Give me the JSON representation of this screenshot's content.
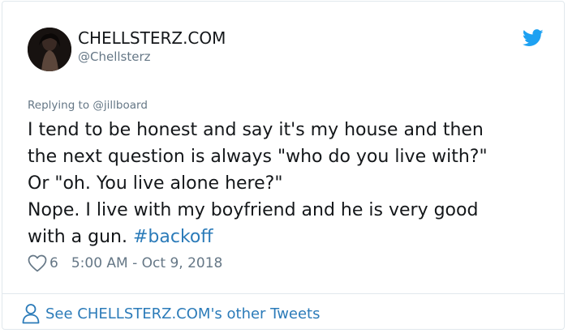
{
  "author": {
    "name": "CHELLSTERZ.COM",
    "handle": "@Chellsterz"
  },
  "tweet": {
    "replying_to": "Replying to @jillboard",
    "lines": [
      "I tend to be honest and say it's my house and then",
      "the next question is always \"who do you live with?\"",
      "Or \"oh. You live alone here?\"",
      "Nope. I live with my boyfriend and he is very good"
    ],
    "last_line_prefix": "with a gun. ",
    "hashtag": "#backoff"
  },
  "meta": {
    "likes": "6",
    "timestamp": "5:00 AM - Oct 9, 2018"
  },
  "footer": {
    "link_text": "See CHELLSTERZ.COM's other Tweets"
  },
  "colors": {
    "link": "#2b7bb9",
    "secondary": "#657786",
    "twitter_blue": "#1da1f2"
  },
  "icons": {
    "brand": "twitter-bird-icon",
    "like": "heart-icon",
    "profile": "person-icon"
  }
}
